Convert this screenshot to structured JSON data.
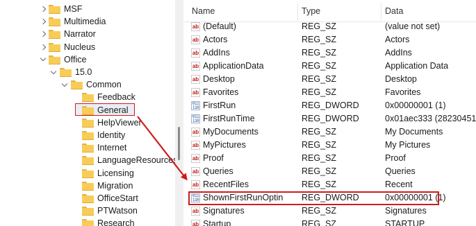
{
  "tree": {
    "items": [
      {
        "label": "MSF",
        "level": 1,
        "expanded": false
      },
      {
        "label": "Multimedia",
        "level": 1,
        "expanded": false
      },
      {
        "label": "Narrator",
        "level": 1,
        "expanded": false
      },
      {
        "label": "Nucleus",
        "level": 1,
        "expanded": false
      },
      {
        "label": "Office",
        "level": 1,
        "expanded": true
      },
      {
        "label": "15.0",
        "level": 2,
        "expanded": true
      },
      {
        "label": "Common",
        "level": 3,
        "expanded": true
      },
      {
        "label": "Feedback",
        "level": 4,
        "expanded": null
      },
      {
        "label": "General",
        "level": 4,
        "expanded": null,
        "selected": true
      },
      {
        "label": "HelpViewer",
        "level": 4,
        "expanded": false
      },
      {
        "label": "Identity",
        "level": 4,
        "expanded": false
      },
      {
        "label": "Internet",
        "level": 4,
        "expanded": false
      },
      {
        "label": "LanguageResources",
        "level": 4,
        "expanded": false
      },
      {
        "label": "Licensing",
        "level": 4,
        "expanded": false
      },
      {
        "label": "Migration",
        "level": 4,
        "expanded": false
      },
      {
        "label": "OfficeStart",
        "level": 4,
        "expanded": false
      },
      {
        "label": "PTWatson",
        "level": 4,
        "expanded": false
      },
      {
        "label": "Research",
        "level": 4,
        "expanded": false
      }
    ]
  },
  "values": {
    "headers": {
      "name": "Name",
      "type": "Type",
      "data": "Data"
    },
    "rows": [
      {
        "name": "(Default)",
        "type": "REG_SZ",
        "data": "(value not set)",
        "icon": "string-value-icon"
      },
      {
        "name": "Actors",
        "type": "REG_SZ",
        "data": "Actors",
        "icon": "string-value-icon"
      },
      {
        "name": "AddIns",
        "type": "REG_SZ",
        "data": "AddIns",
        "icon": "string-value-icon"
      },
      {
        "name": "ApplicationData",
        "type": "REG_SZ",
        "data": "Application Data",
        "icon": "string-value-icon"
      },
      {
        "name": "Desktop",
        "type": "REG_SZ",
        "data": "Desktop",
        "icon": "string-value-icon"
      },
      {
        "name": "Favorites",
        "type": "REG_SZ",
        "data": "Favorites",
        "icon": "string-value-icon"
      },
      {
        "name": "FirstRun",
        "type": "REG_DWORD",
        "data": "0x00000001 (1)",
        "icon": "binary-value-icon"
      },
      {
        "name": "FirstRunTime",
        "type": "REG_DWORD",
        "data": "0x01aec333 (28230451)",
        "icon": "binary-value-icon"
      },
      {
        "name": "MyDocuments",
        "type": "REG_SZ",
        "data": "My Documents",
        "icon": "string-value-icon"
      },
      {
        "name": "MyPictures",
        "type": "REG_SZ",
        "data": "My Pictures",
        "icon": "string-value-icon"
      },
      {
        "name": "Proof",
        "type": "REG_SZ",
        "data": "Proof",
        "icon": "string-value-icon"
      },
      {
        "name": "Queries",
        "type": "REG_SZ",
        "data": "Queries",
        "icon": "string-value-icon"
      },
      {
        "name": "RecentFiles",
        "type": "REG_SZ",
        "data": "Recent",
        "icon": "string-value-icon"
      },
      {
        "name": "ShownFirstRunOptin",
        "type": "REG_DWORD",
        "data": "0x00000001 (1)",
        "icon": "binary-value-icon",
        "highlighted": true
      },
      {
        "name": "Signatures",
        "type": "REG_SZ",
        "data": "Signatures",
        "icon": "string-value-icon"
      },
      {
        "name": "Startup",
        "type": "REG_SZ",
        "data": "STARTUP",
        "icon": "string-value-icon"
      }
    ]
  },
  "icons": {
    "string": "ab",
    "binary": "011\n110"
  },
  "colors": {
    "annotation_red": "#cc1c1c",
    "folder": "#f8cc58",
    "selection": "#e9eef5"
  }
}
